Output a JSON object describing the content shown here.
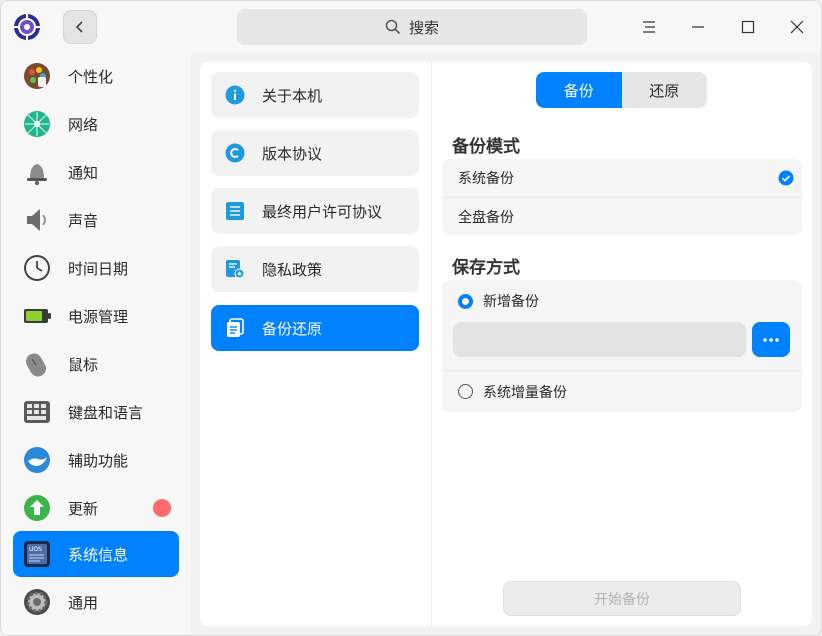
{
  "window": {
    "search_label": "搜索",
    "accent_color": "#0081ff"
  },
  "sidebar": {
    "items": [
      {
        "label": "个性化",
        "icon": "personalization-icon"
      },
      {
        "label": "网络",
        "icon": "network-icon"
      },
      {
        "label": "通知",
        "icon": "bell-icon"
      },
      {
        "label": "声音",
        "icon": "speaker-icon"
      },
      {
        "label": "时间日期",
        "icon": "clock-icon"
      },
      {
        "label": "电源管理",
        "icon": "battery-icon"
      },
      {
        "label": "鼠标",
        "icon": "mouse-icon"
      },
      {
        "label": "键盘和语言",
        "icon": "keyboard-icon"
      },
      {
        "label": "辅助功能",
        "icon": "accessibility-icon"
      },
      {
        "label": "更新",
        "icon": "update-icon"
      },
      {
        "label": "系统信息",
        "icon": "system-info-icon"
      },
      {
        "label": "通用",
        "icon": "general-icon"
      }
    ],
    "active_index": 10
  },
  "middle": {
    "items": [
      {
        "label": "关于本机",
        "icon": "info-icon"
      },
      {
        "label": "版本协议",
        "icon": "copyright-icon"
      },
      {
        "label": "最终用户许可协议",
        "icon": "document-icon"
      },
      {
        "label": "隐私政策",
        "icon": "privacy-icon"
      },
      {
        "label": "备份还原",
        "icon": "backup-icon"
      }
    ],
    "active_index": 4
  },
  "right": {
    "tabs": [
      "备份",
      "还原"
    ],
    "mode_title": "备份模式",
    "mode_options": [
      "系统备份",
      "全盘备份"
    ],
    "mode_selected": "系统备份",
    "save_title": "保存方式",
    "save_options": [
      "新增备份",
      "系统增量备份"
    ],
    "save_selected": "新增备份",
    "path_value": "",
    "start_button": "开始备份"
  }
}
